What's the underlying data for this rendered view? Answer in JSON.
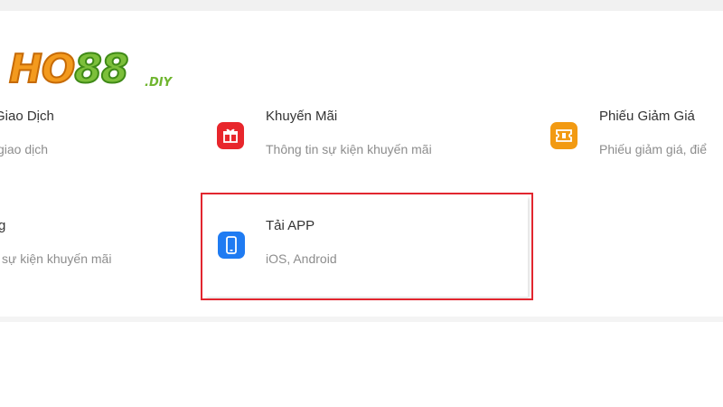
{
  "logo": {
    "main_a": "HO",
    "main_b": "88",
    "suffix": ".DIY"
  },
  "menu": {
    "items": [
      {
        "title": "Giao Dịch",
        "desc": "giao dịch",
        "icon": "transaction-icon"
      },
      {
        "title": "Khuyến Mãi",
        "desc": "Thông tin sự kiện khuyến mãi",
        "icon": "gift-icon",
        "color": "#e8262c"
      },
      {
        "title": "Phiếu Giảm Giá",
        "desc": "Phiếu giảm giá, điể",
        "icon": "ticket-icon",
        "color": "#f29a12"
      },
      {
        "title": "g",
        "desc": "sự kiện khuyến mãi",
        "icon": "event-icon"
      },
      {
        "title": "Tải APP",
        "desc": "iOS, Android",
        "icon": "mobile-phone-icon",
        "color": "#1f7bf2"
      }
    ]
  },
  "highlight_color": "#e2262f"
}
